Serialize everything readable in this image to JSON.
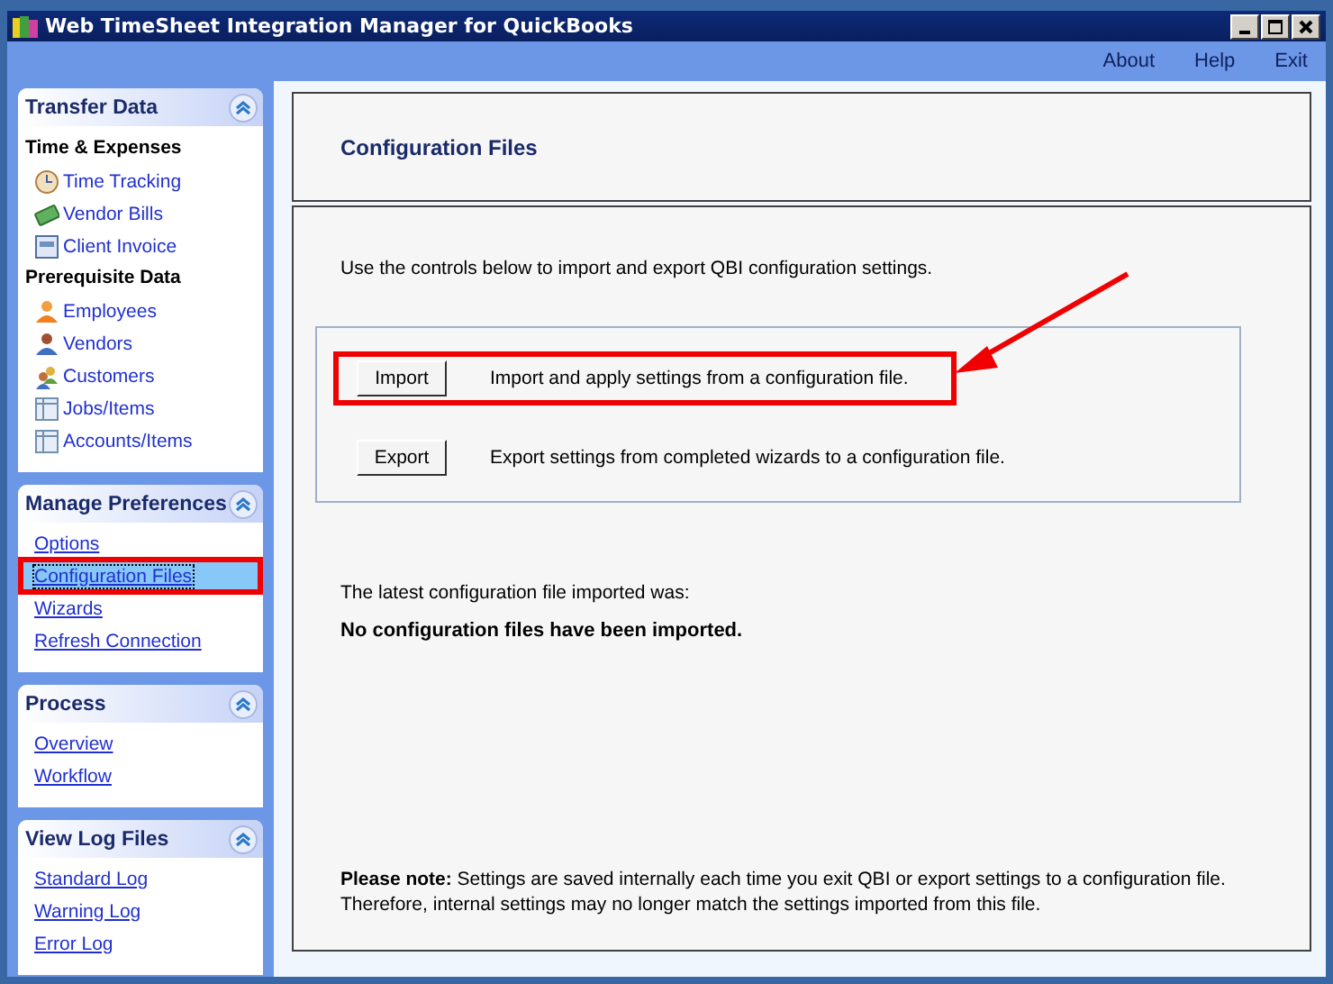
{
  "window": {
    "title": "Web TimeSheet Integration Manager for QuickBooks"
  },
  "menu": [
    "About",
    "Help",
    "Exit"
  ],
  "sidebar": [
    {
      "title": "Transfer Data",
      "expanded": true,
      "groups": [
        {
          "heading": "Time & Expenses",
          "items": [
            {
              "label": "Time Tracking",
              "kind": "icon-link",
              "selected": false,
              "highlighted": false
            },
            {
              "label": "Vendor Bills",
              "kind": "icon-link",
              "selected": false,
              "highlighted": false
            },
            {
              "label": "Client Invoice",
              "kind": "icon-link",
              "selected": false,
              "highlighted": false
            }
          ]
        },
        {
          "heading": "Prerequisite Data",
          "items": [
            {
              "label": "Employees",
              "kind": "icon-link",
              "selected": false,
              "highlighted": false
            },
            {
              "label": "Vendors",
              "kind": "icon-link",
              "selected": false,
              "highlighted": false
            },
            {
              "label": "Customers",
              "kind": "icon-link",
              "selected": false,
              "highlighted": false
            },
            {
              "label": "Jobs/Items",
              "kind": "icon-link",
              "selected": false,
              "highlighted": false
            },
            {
              "label": "Accounts/Items",
              "kind": "icon-link",
              "selected": false,
              "highlighted": false
            }
          ]
        }
      ]
    },
    {
      "title": "Manage Preferences",
      "expanded": true,
      "groups": [
        {
          "items": [
            {
              "label": "Options",
              "kind": "link",
              "selected": false,
              "highlighted": false
            },
            {
              "label": "Configuration Files",
              "kind": "link",
              "selected": true,
              "highlighted": true
            },
            {
              "label": "Wizards",
              "kind": "link",
              "selected": false,
              "highlighted": false
            },
            {
              "label": "Refresh Connection",
              "kind": "link",
              "selected": false,
              "highlighted": false
            }
          ]
        }
      ]
    },
    {
      "title": "Process",
      "expanded": true,
      "groups": [
        {
          "items": [
            {
              "label": "Overview",
              "kind": "link",
              "selected": false,
              "highlighted": false
            },
            {
              "label": "Workflow",
              "kind": "link",
              "selected": false,
              "highlighted": false
            }
          ]
        }
      ]
    },
    {
      "title": "View Log Files",
      "expanded": true,
      "groups": [
        {
          "items": [
            {
              "label": "Standard Log",
              "kind": "link",
              "selected": false,
              "highlighted": false
            },
            {
              "label": "Warning Log",
              "kind": "link",
              "selected": false,
              "highlighted": false
            },
            {
              "label": "Error Log",
              "kind": "link",
              "selected": false,
              "highlighted": false
            }
          ]
        }
      ]
    }
  ],
  "page": {
    "title": "Configuration Files",
    "intro": "Use the controls below to import and export QBI configuration settings.",
    "actions": [
      {
        "button": "Import",
        "description": "Import and apply settings from a configuration file.",
        "highlighted": true
      },
      {
        "button": "Export",
        "description": "Export settings from completed wizards to a configuration file.",
        "highlighted": false
      }
    ],
    "last_import_label": "The latest configuration file imported was:",
    "last_import_value": "No configuration files have been imported.",
    "note": "**Please note:** Settings are saved internally each time you exit QBI or export settings to a configuration file. Therefore, internal settings may no longer match the settings imported from this file."
  }
}
